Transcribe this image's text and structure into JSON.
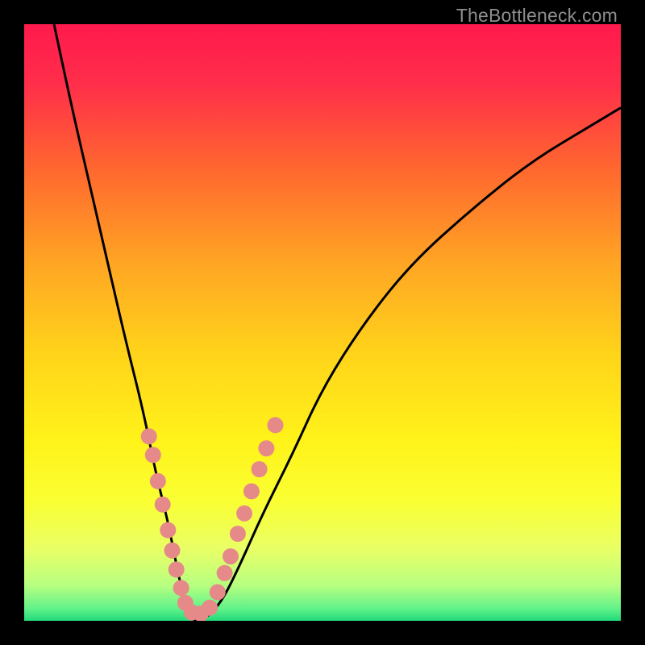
{
  "watermark": "TheBottleneck.com",
  "gradient_stops": [
    {
      "offset": 0.0,
      "color": "#ff1a4d"
    },
    {
      "offset": 0.1,
      "color": "#ff2e4a"
    },
    {
      "offset": 0.25,
      "color": "#ff6a2e"
    },
    {
      "offset": 0.4,
      "color": "#ffa524"
    },
    {
      "offset": 0.55,
      "color": "#ffd31a"
    },
    {
      "offset": 0.7,
      "color": "#fff31a"
    },
    {
      "offset": 0.8,
      "color": "#faff33"
    },
    {
      "offset": 0.88,
      "color": "#e9ff66"
    },
    {
      "offset": 0.94,
      "color": "#b8ff80"
    },
    {
      "offset": 0.98,
      "color": "#60f28a"
    },
    {
      "offset": 1.0,
      "color": "#22d97a"
    }
  ],
  "curve_color": "#000000",
  "curve_width": 3.0,
  "dot_color": "#e58a88",
  "dot_radius": 10,
  "chart_data": {
    "type": "line",
    "title": "",
    "xlabel": "",
    "ylabel": "",
    "x": [
      0.05,
      0.08,
      0.11,
      0.14,
      0.17,
      0.2,
      0.22,
      0.24,
      0.25,
      0.26,
      0.27,
      0.28,
      0.3,
      0.33,
      0.36,
      0.4,
      0.45,
      0.5,
      0.57,
      0.65,
      0.75,
      0.85,
      0.95,
      1.0
    ],
    "y": [
      1.0,
      0.86,
      0.73,
      0.6,
      0.47,
      0.35,
      0.25,
      0.17,
      0.12,
      0.07,
      0.03,
      0.0,
      0.0,
      0.03,
      0.09,
      0.18,
      0.28,
      0.39,
      0.5,
      0.6,
      0.69,
      0.77,
      0.83,
      0.86
    ],
    "xlim": [
      0,
      1
    ],
    "ylim": [
      0,
      1
    ],
    "note": "Values are normalized fractions of the 740x740 plot area; y measured from bottom. Curve resembles a V / check-shaped bottleneck plot with minimum near x≈0.28.",
    "marker_points_left": [
      {
        "x": 0.209,
        "y": 0.309
      },
      {
        "x": 0.216,
        "y": 0.278
      },
      {
        "x": 0.224,
        "y": 0.234
      },
      {
        "x": 0.232,
        "y": 0.195
      },
      {
        "x": 0.241,
        "y": 0.152
      },
      {
        "x": 0.248,
        "y": 0.118
      },
      {
        "x": 0.255,
        "y": 0.086
      },
      {
        "x": 0.263,
        "y": 0.055
      }
    ],
    "marker_points_bottom": [
      {
        "x": 0.27,
        "y": 0.03
      },
      {
        "x": 0.281,
        "y": 0.014
      },
      {
        "x": 0.296,
        "y": 0.012
      },
      {
        "x": 0.311,
        "y": 0.022
      }
    ],
    "marker_points_right": [
      {
        "x": 0.324,
        "y": 0.048
      },
      {
        "x": 0.336,
        "y": 0.08
      },
      {
        "x": 0.346,
        "y": 0.108
      },
      {
        "x": 0.358,
        "y": 0.146
      },
      {
        "x": 0.369,
        "y": 0.18
      },
      {
        "x": 0.381,
        "y": 0.217
      },
      {
        "x": 0.394,
        "y": 0.254
      },
      {
        "x": 0.406,
        "y": 0.289
      },
      {
        "x": 0.421,
        "y": 0.328
      }
    ]
  }
}
